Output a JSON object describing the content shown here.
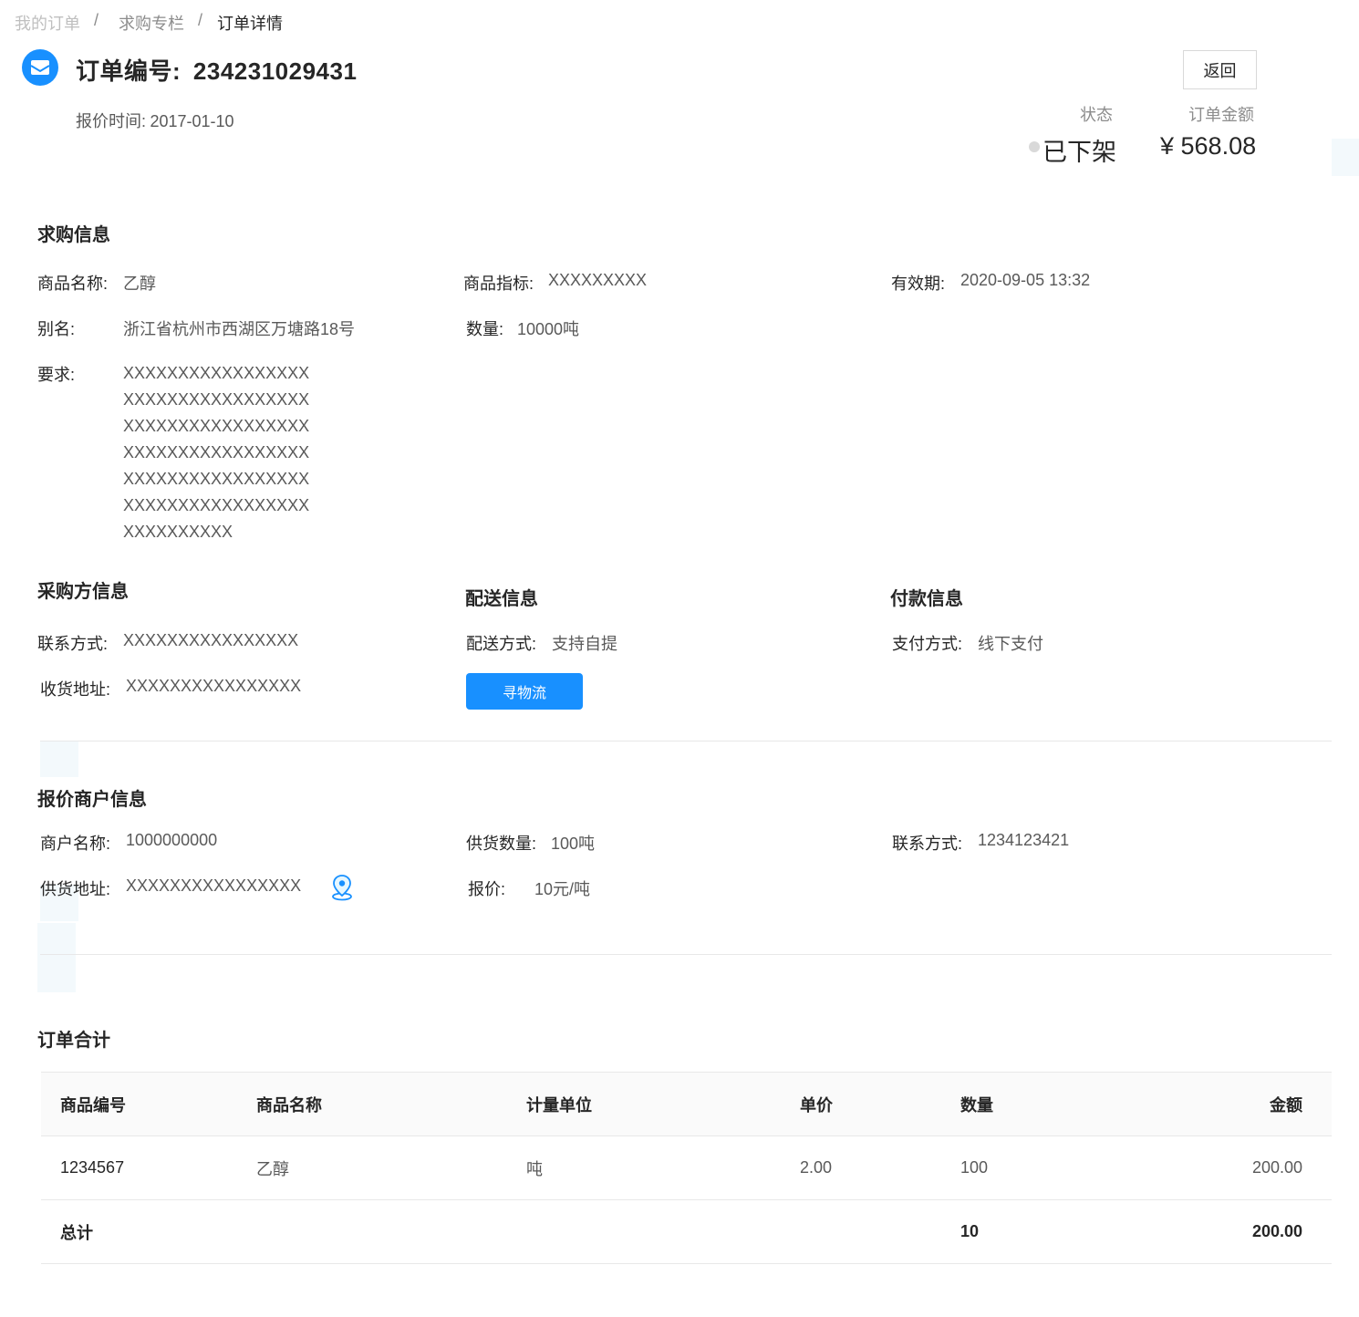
{
  "breadcrumb": [
    "我的订单",
    "求购专栏",
    "订单详情"
  ],
  "header": {
    "order_label": "订单编号:",
    "order_no": "234231029431",
    "quote_time_label": "报价时间:",
    "quote_time": "2017-01-10",
    "back_label": "返回",
    "status_label": "状态",
    "status_value": "已下架",
    "amount_label": "订单金额",
    "amount_value": "¥ 568.08"
  },
  "purchase_info": {
    "title": "求购信息",
    "product_name_label": "商品名称:",
    "product_name": "乙醇",
    "product_spec_label": "商品指标:",
    "product_spec": "XXXXXXXXX",
    "validity_label": "有效期:",
    "validity": "2020-09-05 13:32",
    "alias_label": "别名:",
    "alias": "浙江省杭州市西湖区万塘路18号",
    "quantity_label": "数量:",
    "quantity": "10000吨",
    "requirement_label": "要求:",
    "requirement_lines": [
      "XXXXXXXXXXXXXXXXX",
      "XXXXXXXXXXXXXXXXX",
      "XXXXXXXXXXXXXXXXX",
      "XXXXXXXXXXXXXXXXX",
      "XXXXXXXXXXXXXXXXX",
      "XXXXXXXXXXXXXXXXX",
      "XXXXXXXXXX"
    ]
  },
  "buyer_info": {
    "title": "采购方信息",
    "contact_label": "联系方式:",
    "contact": "XXXXXXXXXXXXXXXX",
    "address_label": "收货地址:",
    "address": "XXXXXXXXXXXXXXXX"
  },
  "delivery_info": {
    "title": "配送信息",
    "method_label": "配送方式:",
    "method": "支持自提",
    "logistics_button": "寻物流"
  },
  "payment_info": {
    "title": "付款信息",
    "method_label": "支付方式:",
    "method": "线下支付"
  },
  "merchant_info": {
    "title": "报价商户信息",
    "name_label": "商户名称:",
    "name": "1000000000",
    "supply_qty_label": "供货数量:",
    "supply_qty": "100吨",
    "contact_label": "联系方式:",
    "contact": "1234123421",
    "address_label": "供货地址:",
    "address": "XXXXXXXXXXXXXXXX",
    "address_icon": "location-pin-icon",
    "price_label": "报价:",
    "price": "10元/吨"
  },
  "order_total": {
    "title": "订单合计",
    "columns": [
      "商品编号",
      "商品名称",
      "计量单位",
      "单价",
      "数量",
      "金额"
    ],
    "rows": [
      [
        "1234567",
        "乙醇",
        "吨",
        "2.00",
        "100",
        "200.00"
      ]
    ],
    "total_row": {
      "label": "总计",
      "quantity": "10",
      "amount": "200.00"
    }
  },
  "colors": {
    "primary": "#1890ff",
    "status_dot": "#d9d9d9",
    "divider": "#e8e8e8"
  }
}
